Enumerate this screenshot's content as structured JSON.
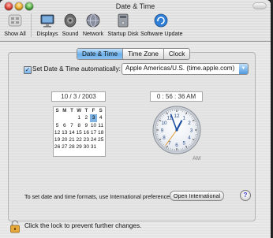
{
  "window": {
    "title": "Date & Time"
  },
  "toolbar": {
    "items": [
      {
        "label": "Show All",
        "icon": "show-all-icon"
      },
      {
        "label": "Displays",
        "icon": "displays-icon"
      },
      {
        "label": "Sound",
        "icon": "sound-icon"
      },
      {
        "label": "Network",
        "icon": "network-icon"
      },
      {
        "label": "Startup Disk",
        "icon": "startup-disk-icon"
      },
      {
        "label": "Software Update",
        "icon": "software-update-icon"
      }
    ]
  },
  "tabs": [
    {
      "label": "Date & Time",
      "selected": true
    },
    {
      "label": "Time Zone",
      "selected": false
    },
    {
      "label": "Clock",
      "selected": false
    }
  ],
  "auto_set": {
    "label": "Set Date & Time automatically:",
    "checked": true,
    "server": "Apple Americas/U.S. (time.apple.com)"
  },
  "date": {
    "display": "10 /  3 / 2003",
    "month": 10,
    "day": 3,
    "year": 2003,
    "weekday_headers": [
      "S",
      "M",
      "T",
      "W",
      "T",
      "F",
      "S"
    ],
    "weeks": [
      [
        "",
        "",
        "",
        "1",
        "2",
        "3",
        "4"
      ],
      [
        "5",
        "6",
        "7",
        "8",
        "9",
        "10",
        "11"
      ],
      [
        "12",
        "13",
        "14",
        "15",
        "16",
        "17",
        "18"
      ],
      [
        "19",
        "20",
        "21",
        "22",
        "23",
        "24",
        "25"
      ],
      [
        "26",
        "27",
        "28",
        "29",
        "30",
        "31",
        ""
      ]
    ],
    "selected_day": "3"
  },
  "time": {
    "display": "0 : 56 : 36 AM",
    "hours": 0,
    "minutes": 56,
    "seconds": 36,
    "meridiem": "AM",
    "clock_numbers": [
      "12",
      "1",
      "2",
      "3",
      "4",
      "5",
      "6",
      "7",
      "8",
      "9",
      "10",
      "11"
    ]
  },
  "footer": {
    "hint": "To set date and time formats, use International preferences.",
    "open_international": "Open International",
    "help": "?",
    "lock_text": "Click the lock to prevent further changes."
  },
  "colors": {
    "selection_blue": "#6aaee9",
    "clock_hand": "#1f4fa0",
    "second_hand": "#e08a12"
  }
}
